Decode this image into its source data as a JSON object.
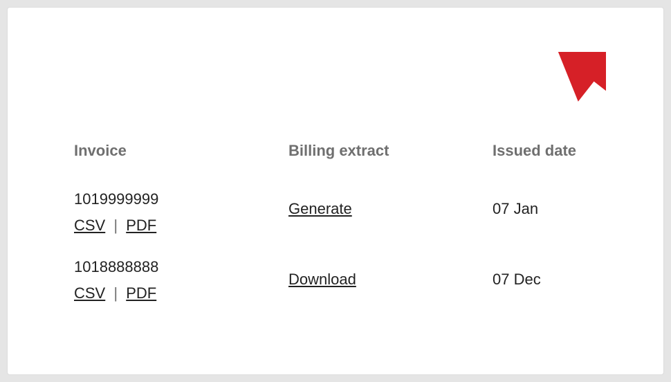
{
  "headers": {
    "invoice": "Invoice",
    "extract": "Billing extract",
    "date": "Issued date"
  },
  "rows": [
    {
      "invoice_number": "1019999999",
      "csv_label": "CSV",
      "pdf_label": "PDF",
      "extract_action": "Generate",
      "issued": "07 Jan"
    },
    {
      "invoice_number": "1018888888",
      "csv_label": "CSV",
      "pdf_label": "PDF",
      "extract_action": "Download",
      "issued": "07 Dec"
    }
  ],
  "separator": "|",
  "arrow_color": "#d62027"
}
